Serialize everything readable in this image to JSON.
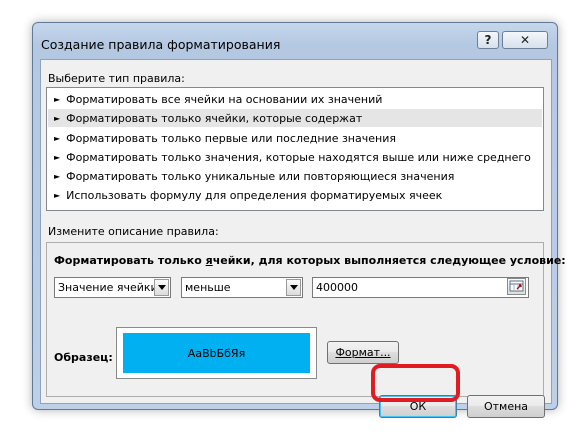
{
  "window": {
    "title": "Создание правила форматирования",
    "help_glyph": "?",
    "close_glyph": "✕"
  },
  "rule_type": {
    "label": "Выберите тип правила:",
    "items": [
      {
        "label": "Форматировать все ячейки на основании их значений",
        "selected": false
      },
      {
        "label": "Форматировать только ячейки, которые содержат",
        "selected": true
      },
      {
        "label": "Форматировать только первые или последние значения",
        "selected": false
      },
      {
        "label": "Форматировать только значения, которые находятся выше или ниже среднего",
        "selected": false
      },
      {
        "label": "Форматировать только уникальные или повторяющиеся значения",
        "selected": false
      },
      {
        "label": "Использовать формулу для определения форматируемых ячеек",
        "selected": false
      }
    ],
    "bullet": "►"
  },
  "rule_description": {
    "label": "Измените описание правила:",
    "condition_title_before": "Форматировать только ",
    "condition_title_underlined": "я",
    "condition_title_after": "чейки, для которых выполняется следующее условие:",
    "field_select": "Значение ячейки",
    "operator_select": "меньше",
    "value": "400000",
    "preview_label": "Образец:",
    "preview_text": "АаВbБбЯя",
    "preview_fill": "#00b0f0",
    "format_button": "Формат..."
  },
  "buttons": {
    "ok": "ОК",
    "cancel": "Отмена"
  },
  "colors": {
    "highlight": "#e11b22",
    "selected_row": "#e5e5e5"
  }
}
